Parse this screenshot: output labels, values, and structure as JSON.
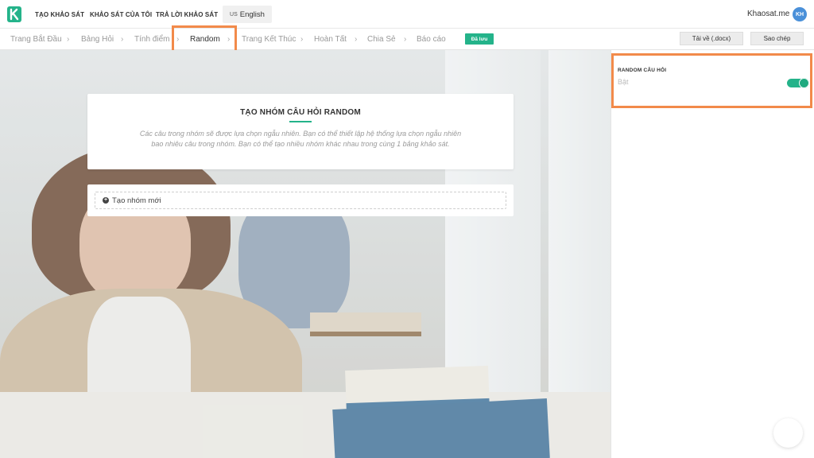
{
  "nav": {
    "items": [
      "TẠO KHẢO SÁT",
      "KHẢO SÁT CỦA TÔI",
      "TRẢ LỜI KHẢO SÁT"
    ],
    "lang_code": "US",
    "lang_label": "English",
    "site_name": "Khaosat.me",
    "avatar_initials": "KH"
  },
  "breadcrumb": {
    "items": [
      "Trang Bắt Đầu",
      "Bảng Hỏi",
      "Tính điểm",
      "Random",
      "Trang Kết Thúc",
      "Hoàn Tất",
      "Chia Sẻ",
      "Báo cáo"
    ],
    "active": "Random",
    "saved_badge": "Đã lưu",
    "download_button": "Tải về (.docx)",
    "copy_button": "Sao chép"
  },
  "card": {
    "title": "TẠO NHÓM CÂU HỎI RANDOM",
    "description": "Các câu trong nhóm sẽ được lựa chọn ngẫu nhiên. Bạn có thể thiết lập hệ thống lựa chọn ngẫu nhiên bao nhiêu câu trong nhóm. Bạn có thể tạo nhiều nhóm khác nhau trong cùng 1 bảng khảo sát."
  },
  "add_group": {
    "label": "Tạo nhóm mới"
  },
  "panel": {
    "label": "RANDOM CÂU HỎI",
    "value": "Bật",
    "toggle_on": true
  },
  "colors": {
    "accent": "#24b38a",
    "highlight": "#f28a4a",
    "avatar": "#4a90d9"
  }
}
